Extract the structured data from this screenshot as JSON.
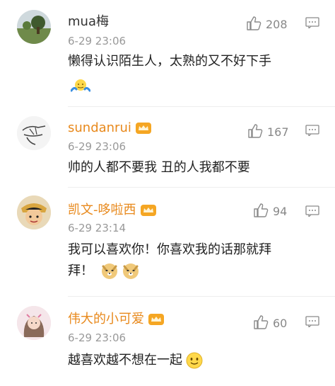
{
  "comments": [
    {
      "user": "mua梅",
      "time": "6-29 23:06",
      "likes": "208",
      "text": "懒得认识陌生人，太熟的又不好下手",
      "avatar_icon": "landscape-avatar"
    },
    {
      "user": "sundanrui",
      "time": "6-29 23:06",
      "likes": "167",
      "text": "帅的人都不要我 丑的人我都不要",
      "avatar_icon": "hand-drawing-avatar"
    },
    {
      "user": "凯文-哆啦西",
      "time": "6-29 23:14",
      "likes": "94",
      "text_line1": "我可以喜欢你！你喜欢我的话那就拜",
      "text_line2": "拜！",
      "avatar_icon": "cartoon-boy-avatar"
    },
    {
      "user": "伟大的小可爱",
      "time": "6-29 23:06",
      "likes": "60",
      "text": "越喜欢越不想在一起",
      "avatar_icon": "girl-avatar"
    }
  ],
  "colors": {
    "vip_name": "#e8891c",
    "plain_name": "#333333",
    "meta": "#999999"
  }
}
